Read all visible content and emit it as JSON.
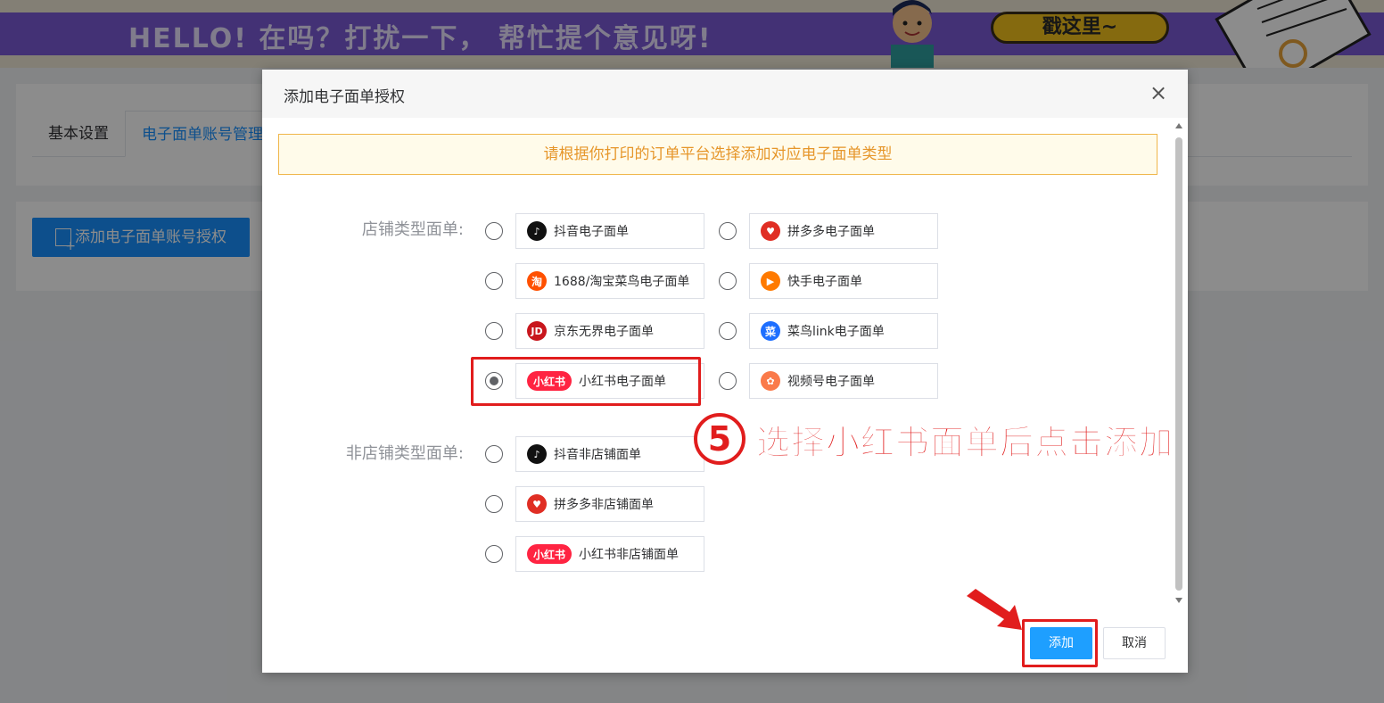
{
  "banner": {
    "headline": "HELLO! 在吗？打扰一下， 帮忙提个意见呀!",
    "cta": "戳这里~"
  },
  "page": {
    "tabs": [
      {
        "label": "基本设置"
      },
      {
        "label": "电子面单账号管理"
      }
    ],
    "add_auth_button": "添加电子面单账号授权"
  },
  "dialog": {
    "title": "添加电子面单授权",
    "close_icon": "×",
    "notice": "请根据你打印的订单平台选择添加对应电子面单类型",
    "shop_group_label": "店铺类型面单:",
    "nonshop_group_label": "非店铺类型面单:",
    "shop_options": [
      {
        "label": "抖音电子面单",
        "icon": "douyin-icon",
        "selected": false
      },
      {
        "label": "拼多多电子面单",
        "icon": "pinduoduo-icon",
        "selected": false
      },
      {
        "label": "1688/淘宝菜鸟电子面单",
        "icon": "taobao-icon",
        "selected": false
      },
      {
        "label": "快手电子面单",
        "icon": "kuaishou-icon",
        "selected": false
      },
      {
        "label": "京东无界电子面单",
        "icon": "jd-icon",
        "selected": false
      },
      {
        "label": "菜鸟link电子面单",
        "icon": "cainiao-icon",
        "selected": false
      },
      {
        "label": "小红书电子面单",
        "icon": "xiaohongshu-icon",
        "selected": true
      },
      {
        "label": "视频号电子面单",
        "icon": "shipinhao-icon",
        "selected": false
      }
    ],
    "nonshop_options": [
      {
        "label": "抖音非店铺面单",
        "icon": "douyin-icon",
        "selected": false
      },
      {
        "label": "拼多多非店铺面单",
        "icon": "pinduoduo-icon",
        "selected": false
      },
      {
        "label": "小红书非店铺面单",
        "icon": "xiaohongshu-icon",
        "selected": false
      }
    ],
    "logo_text": {
      "taobao": "淘",
      "jd": "JD",
      "cainiao": "菜",
      "xhs": "小红书"
    },
    "add_button": "添加",
    "cancel_button": "取消"
  },
  "annotation": {
    "step_number": "5",
    "text": "选择小红书面单后点击添加"
  },
  "colors": {
    "primary": "#1e9fff",
    "annotation_red": "#e11d1d",
    "notice_text": "#e6962a",
    "banner_purple": "#7b59d6"
  }
}
